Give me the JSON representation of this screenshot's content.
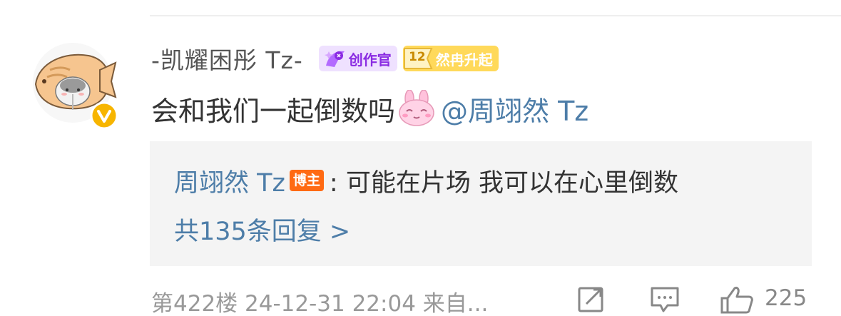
{
  "comment": {
    "username": "-凯耀困彤 Tz-",
    "creator_badge": "创作官",
    "fan_badge": {
      "level": "12",
      "label": "然冉升起"
    },
    "text": "会和我们一起倒数吗",
    "emoji_icon": "pink-bunny-emoji-icon",
    "mention": "@周翊然 Tz",
    "verified_icon": "verified-v-icon"
  },
  "reply": {
    "author": "周翊然 Tz",
    "author_badge": "博主",
    "text": ": 可能在片场 我可以在心里倒数",
    "count_link": "共135条回复 >"
  },
  "footer": {
    "meta": "第422楼  24-12-31 22:04  来自...",
    "like_count": "225",
    "icons": [
      "share-icon",
      "comment-icon",
      "like-icon"
    ]
  },
  "colors": {
    "link_blue": "#4d7da8",
    "creator_purple": "#8a2be2",
    "fan_gold": "#ffd95a",
    "blogger_orange": "#ff6a13",
    "verified_yellow": "#f7b500"
  }
}
